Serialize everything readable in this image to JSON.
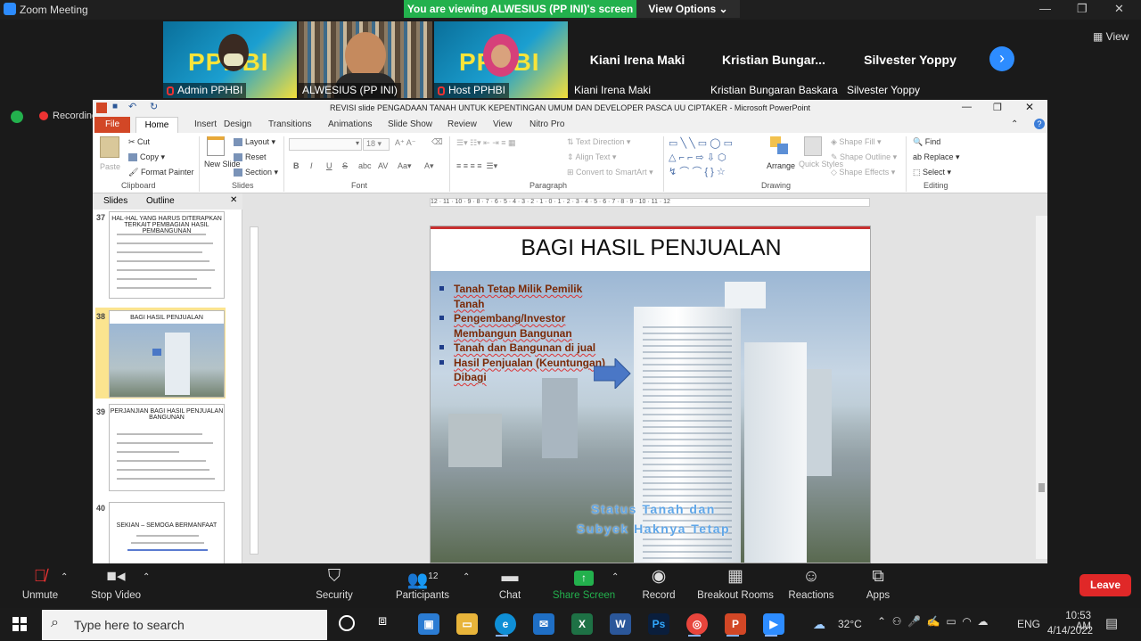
{
  "zoom": {
    "window_title": "Zoom Meeting",
    "viewing_banner": "You are viewing ALWESIUS (PP INI)'s screen",
    "view_options": "View Options",
    "gallery_view": "View",
    "recording": "Recording",
    "participants": [
      {
        "name": "Admin PPHBI",
        "type": "video",
        "logo": "PPHBI"
      },
      {
        "name": "ALWESIUS (PP INI)",
        "type": "video"
      },
      {
        "name": "Host PPHBI",
        "type": "video",
        "logo": "PPHBI"
      },
      {
        "display": "Kiani Irena Maki",
        "name": "Kiani Irena Maki",
        "type": "name"
      },
      {
        "display": "Kristian  Bungar...",
        "name": "Kristian Bungaran Baskara",
        "type": "name"
      },
      {
        "display": "Silvester Yoppy",
        "name": "Silvester Yoppy",
        "type": "name"
      }
    ],
    "toolbar": {
      "unmute": "Unmute",
      "stop_video": "Stop Video",
      "security": "Security",
      "participants": "Participants",
      "participants_count": "12",
      "chat": "Chat",
      "share_screen": "Share Screen",
      "record": "Record",
      "breakout_rooms": "Breakout Rooms",
      "reactions": "Reactions",
      "apps": "Apps",
      "leave": "Leave"
    }
  },
  "ppt": {
    "title": "REVISI slide  PENGADAAN TANAH UNTUK KEPENTINGAN UMUM DAN DEVELOPER PASCA UU CIPTAKER  -  Microsoft PowerPoint",
    "tabs": [
      "File",
      "Home",
      "Insert",
      "Design",
      "Transitions",
      "Animations",
      "Slide Show",
      "Review",
      "View",
      "Nitro Pro"
    ],
    "ribbon": {
      "clipboard": {
        "paste": "Paste",
        "cut": "Cut",
        "copy": "Copy",
        "format_painter": "Format Painter",
        "label": "Clipboard"
      },
      "slides": {
        "new_slide": "New Slide",
        "layout": "Layout",
        "reset": "Reset",
        "section": "Section",
        "label": "Slides"
      },
      "font": {
        "size": "18",
        "label": "Font"
      },
      "paragraph": {
        "text_direction": "Text Direction",
        "align_text": "Align Text",
        "convert": "Convert to SmartArt",
        "label": "Paragraph"
      },
      "drawing": {
        "arrange": "Arrange",
        "quick_styles": "Quick Styles",
        "shape_fill": "Shape Fill",
        "shape_outline": "Shape Outline",
        "shape_effects": "Shape Effects",
        "label": "Drawing"
      },
      "editing": {
        "find": "Find",
        "replace": "Replace",
        "select": "Select",
        "label": "Editing"
      }
    },
    "panel_tabs": {
      "slides": "Slides",
      "outline": "Outline"
    },
    "thumbnails": [
      {
        "num": "37",
        "title": "HAL-HAL YANG HARUS DITERAPKAN TERKAIT PEMBAGIAN  HASIL PEMBANGUNAN"
      },
      {
        "num": "38",
        "title": "BAGI HASIL PENJUALAN"
      },
      {
        "num": "39",
        "title": "PERJANJIAN BAGI HASIL PENJUALAN BANGUNAN"
      },
      {
        "num": "40",
        "title": "SEKIAN – SEMOGA BERMANFAAT"
      }
    ],
    "ruler_top": "12 · 11 · 10 · 9 · 8 · 7 · 6 · 5 · 4 · 3 · 2 · 1 · 0 · 1 · 2 · 3 · 4 · 5 · 6 · 7 · 8 · 9 · 10 · 11 · 12",
    "slide": {
      "title": "BAGI HASIL PENJUALAN",
      "bullets": [
        "Tanah Tetap Milik Pemilik Tanah",
        "Pengembang/Investor Membangun Bangunan",
        "Tanah dan Bangunan di jual",
        "Hasil Penjualan (Keuntungan) Dibagi"
      ],
      "caption_line1": "Status Tanah dan",
      "caption_line2": "Subyek Haknya Tetap"
    }
  },
  "taskbar": {
    "search_placeholder": "Type here to search",
    "temperature": "32°C",
    "language": "ENG",
    "time": "10:53 AM",
    "date": "4/14/2022"
  }
}
